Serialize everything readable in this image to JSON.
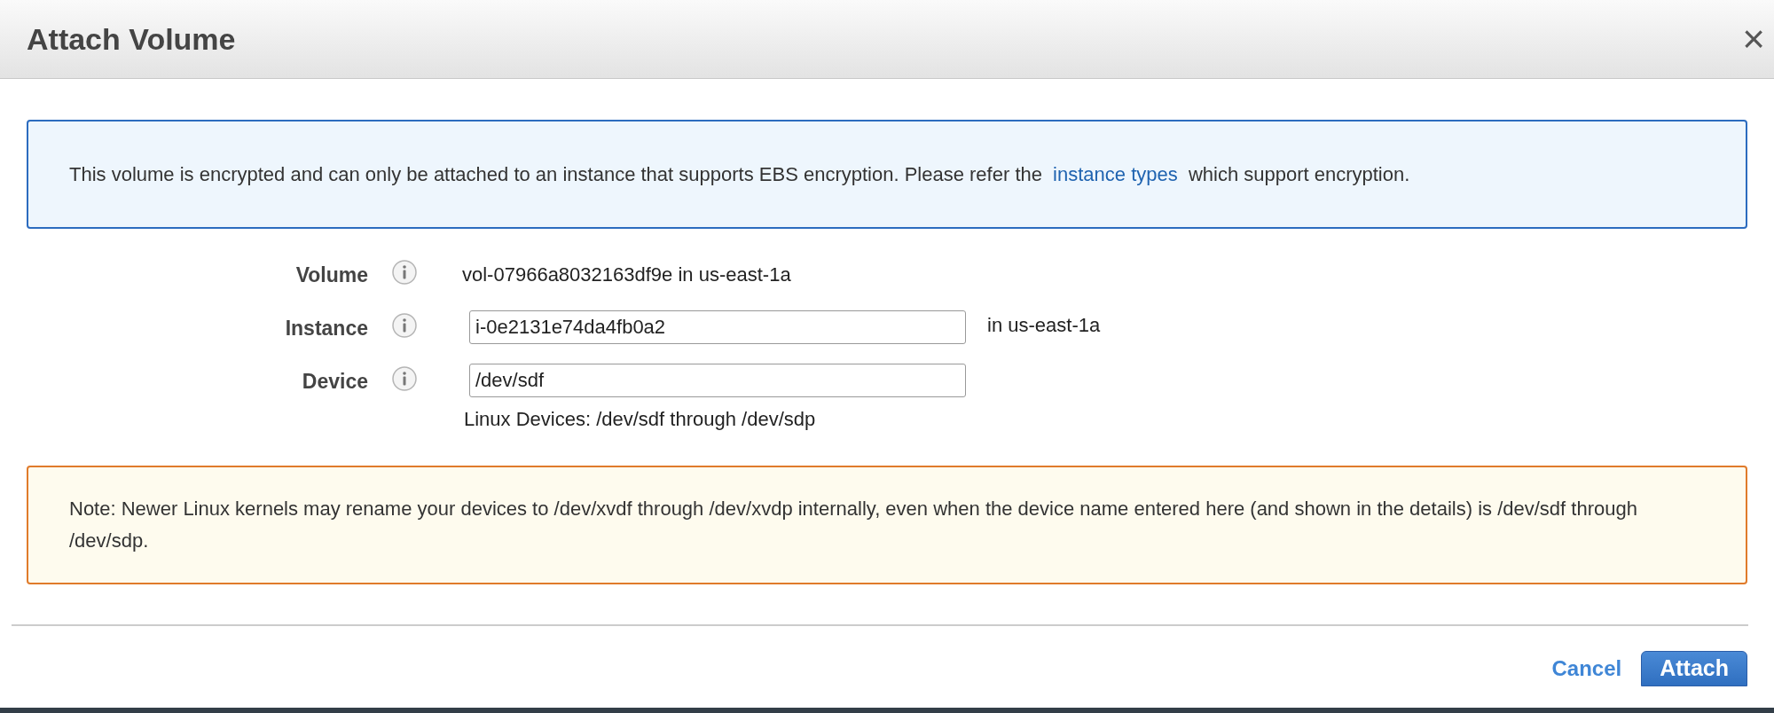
{
  "dialog": {
    "title": "Attach Volume",
    "close": "×"
  },
  "info": {
    "text_before": "This volume is encrypted and can only be attached to an instance that supports EBS encryption. Please refer the",
    "link": "instance types",
    "text_after": "which support encryption."
  },
  "fields": [
    {
      "kind": "text",
      "label": "Volume",
      "value": "vol-07966a8032163df9e in us-east-1a"
    },
    {
      "kind": "input",
      "label": "Instance",
      "value": "i-0e2131e74da4fb0a2",
      "suffix": "in us-east-1a"
    },
    {
      "kind": "input",
      "label": "Device",
      "value": "/dev/sdf",
      "hint": "Linux Devices: /dev/sdf through /dev/sdp"
    }
  ],
  "note": "Note: Newer Linux kernels may rename your devices to /dev/xvdf through /dev/xvdp internally, even when the device name entered here (and shown in the details) is /dev/sdf through /dev/sdp.",
  "buttons": {
    "cancel": "Cancel",
    "primary": "Attach"
  }
}
